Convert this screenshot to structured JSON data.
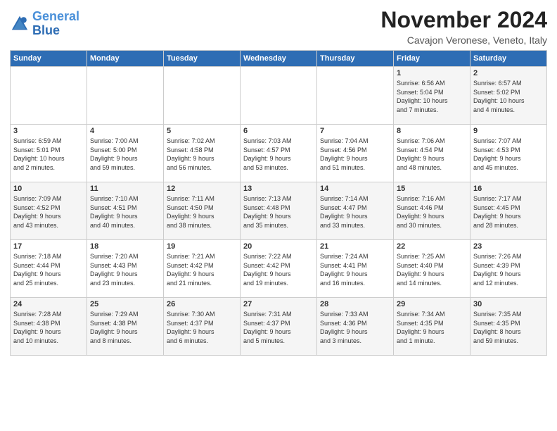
{
  "header": {
    "logo_line1": "General",
    "logo_line2": "Blue",
    "month": "November 2024",
    "location": "Cavajon Veronese, Veneto, Italy"
  },
  "weekdays": [
    "Sunday",
    "Monday",
    "Tuesday",
    "Wednesday",
    "Thursday",
    "Friday",
    "Saturday"
  ],
  "weeks": [
    [
      {
        "day": "",
        "info": ""
      },
      {
        "day": "",
        "info": ""
      },
      {
        "day": "",
        "info": ""
      },
      {
        "day": "",
        "info": ""
      },
      {
        "day": "",
        "info": ""
      },
      {
        "day": "1",
        "info": "Sunrise: 6:56 AM\nSunset: 5:04 PM\nDaylight: 10 hours\nand 7 minutes."
      },
      {
        "day": "2",
        "info": "Sunrise: 6:57 AM\nSunset: 5:02 PM\nDaylight: 10 hours\nand 4 minutes."
      }
    ],
    [
      {
        "day": "3",
        "info": "Sunrise: 6:59 AM\nSunset: 5:01 PM\nDaylight: 10 hours\nand 2 minutes."
      },
      {
        "day": "4",
        "info": "Sunrise: 7:00 AM\nSunset: 5:00 PM\nDaylight: 9 hours\nand 59 minutes."
      },
      {
        "day": "5",
        "info": "Sunrise: 7:02 AM\nSunset: 4:58 PM\nDaylight: 9 hours\nand 56 minutes."
      },
      {
        "day": "6",
        "info": "Sunrise: 7:03 AM\nSunset: 4:57 PM\nDaylight: 9 hours\nand 53 minutes."
      },
      {
        "day": "7",
        "info": "Sunrise: 7:04 AM\nSunset: 4:56 PM\nDaylight: 9 hours\nand 51 minutes."
      },
      {
        "day": "8",
        "info": "Sunrise: 7:06 AM\nSunset: 4:54 PM\nDaylight: 9 hours\nand 48 minutes."
      },
      {
        "day": "9",
        "info": "Sunrise: 7:07 AM\nSunset: 4:53 PM\nDaylight: 9 hours\nand 45 minutes."
      }
    ],
    [
      {
        "day": "10",
        "info": "Sunrise: 7:09 AM\nSunset: 4:52 PM\nDaylight: 9 hours\nand 43 minutes."
      },
      {
        "day": "11",
        "info": "Sunrise: 7:10 AM\nSunset: 4:51 PM\nDaylight: 9 hours\nand 40 minutes."
      },
      {
        "day": "12",
        "info": "Sunrise: 7:11 AM\nSunset: 4:50 PM\nDaylight: 9 hours\nand 38 minutes."
      },
      {
        "day": "13",
        "info": "Sunrise: 7:13 AM\nSunset: 4:48 PM\nDaylight: 9 hours\nand 35 minutes."
      },
      {
        "day": "14",
        "info": "Sunrise: 7:14 AM\nSunset: 4:47 PM\nDaylight: 9 hours\nand 33 minutes."
      },
      {
        "day": "15",
        "info": "Sunrise: 7:16 AM\nSunset: 4:46 PM\nDaylight: 9 hours\nand 30 minutes."
      },
      {
        "day": "16",
        "info": "Sunrise: 7:17 AM\nSunset: 4:45 PM\nDaylight: 9 hours\nand 28 minutes."
      }
    ],
    [
      {
        "day": "17",
        "info": "Sunrise: 7:18 AM\nSunset: 4:44 PM\nDaylight: 9 hours\nand 25 minutes."
      },
      {
        "day": "18",
        "info": "Sunrise: 7:20 AM\nSunset: 4:43 PM\nDaylight: 9 hours\nand 23 minutes."
      },
      {
        "day": "19",
        "info": "Sunrise: 7:21 AM\nSunset: 4:42 PM\nDaylight: 9 hours\nand 21 minutes."
      },
      {
        "day": "20",
        "info": "Sunrise: 7:22 AM\nSunset: 4:42 PM\nDaylight: 9 hours\nand 19 minutes."
      },
      {
        "day": "21",
        "info": "Sunrise: 7:24 AM\nSunset: 4:41 PM\nDaylight: 9 hours\nand 16 minutes."
      },
      {
        "day": "22",
        "info": "Sunrise: 7:25 AM\nSunset: 4:40 PM\nDaylight: 9 hours\nand 14 minutes."
      },
      {
        "day": "23",
        "info": "Sunrise: 7:26 AM\nSunset: 4:39 PM\nDaylight: 9 hours\nand 12 minutes."
      }
    ],
    [
      {
        "day": "24",
        "info": "Sunrise: 7:28 AM\nSunset: 4:38 PM\nDaylight: 9 hours\nand 10 minutes."
      },
      {
        "day": "25",
        "info": "Sunrise: 7:29 AM\nSunset: 4:38 PM\nDaylight: 9 hours\nand 8 minutes."
      },
      {
        "day": "26",
        "info": "Sunrise: 7:30 AM\nSunset: 4:37 PM\nDaylight: 9 hours\nand 6 minutes."
      },
      {
        "day": "27",
        "info": "Sunrise: 7:31 AM\nSunset: 4:37 PM\nDaylight: 9 hours\nand 5 minutes."
      },
      {
        "day": "28",
        "info": "Sunrise: 7:33 AM\nSunset: 4:36 PM\nDaylight: 9 hours\nand 3 minutes."
      },
      {
        "day": "29",
        "info": "Sunrise: 7:34 AM\nSunset: 4:35 PM\nDaylight: 9 hours\nand 1 minute."
      },
      {
        "day": "30",
        "info": "Sunrise: 7:35 AM\nSunset: 4:35 PM\nDaylight: 8 hours\nand 59 minutes."
      }
    ]
  ]
}
